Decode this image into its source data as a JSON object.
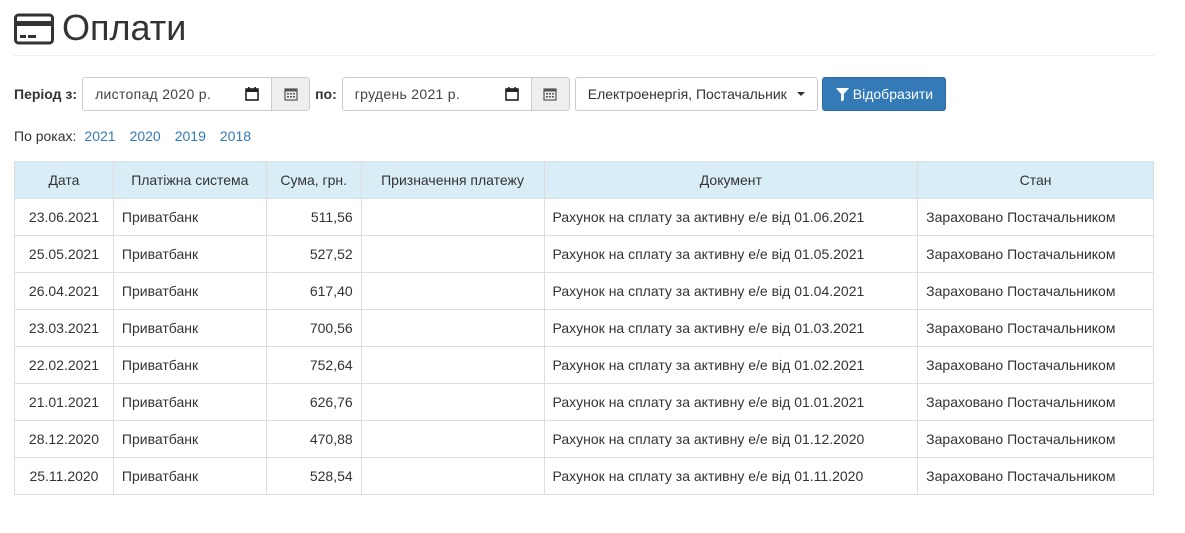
{
  "page": {
    "title": "Оплати"
  },
  "filters": {
    "period_from_label": "Період з:",
    "period_from_value": "листопад  2020 р.",
    "period_to_label": "по:",
    "period_to_value": "грудень  2021 р.",
    "service_select_value": "Електроенергія, Постачальник",
    "show_button_label": "Відобразити"
  },
  "years": {
    "label": "По роках:",
    "items": [
      "2021",
      "2020",
      "2019",
      "2018"
    ]
  },
  "table": {
    "headers": [
      "Дата",
      "Платіжна система",
      "Сума, грн.",
      "Призначення платежу",
      "Документ",
      "Стан"
    ],
    "rows": [
      {
        "date": "23.06.2021",
        "system": "Приватбанк",
        "sum": "511,56",
        "purpose": "",
        "document": "Рахунок на сплату за активну е/е від 01.06.2021",
        "status": "Зараховано Постачальником"
      },
      {
        "date": "25.05.2021",
        "system": "Приватбанк",
        "sum": "527,52",
        "purpose": "",
        "document": "Рахунок на сплату за активну е/е від 01.05.2021",
        "status": "Зараховано Постачальником"
      },
      {
        "date": "26.04.2021",
        "system": "Приватбанк",
        "sum": "617,40",
        "purpose": "",
        "document": "Рахунок на сплату за активну е/е від 01.04.2021",
        "status": "Зараховано Постачальником"
      },
      {
        "date": "23.03.2021",
        "system": "Приватбанк",
        "sum": "700,56",
        "purpose": "",
        "document": "Рахунок на сплату за активну е/е від 01.03.2021",
        "status": "Зараховано Постачальником"
      },
      {
        "date": "22.02.2021",
        "system": "Приватбанк",
        "sum": "752,64",
        "purpose": "",
        "document": "Рахунок на сплату за активну е/е від 01.02.2021",
        "status": "Зараховано Постачальником"
      },
      {
        "date": "21.01.2021",
        "system": "Приватбанк",
        "sum": "626,76",
        "purpose": "",
        "document": "Рахунок на сплату за активну е/е від 01.01.2021",
        "status": "Зараховано Постачальником"
      },
      {
        "date": "28.12.2020",
        "system": "Приватбанк",
        "sum": "470,88",
        "purpose": "",
        "document": "Рахунок на сплату за активну е/е від 01.12.2020",
        "status": "Зараховано Постачальником"
      },
      {
        "date": "25.11.2020",
        "system": "Приватбанк",
        "sum": "528,54",
        "purpose": "",
        "document": "Рахунок на сплату за активну е/е від 01.11.2020",
        "status": "Зараховано Постачальником"
      }
    ]
  },
  "colors": {
    "accent": "#337ab7",
    "table_header_bg": "#d9edf7",
    "addon_bg": "#eeeeee"
  },
  "icons": {
    "title": "credit-card-icon",
    "date_picker": "calendar-icon",
    "date_addon": "calendar-grid-icon",
    "button": "filter-icon",
    "select": "caret-down-icon"
  }
}
